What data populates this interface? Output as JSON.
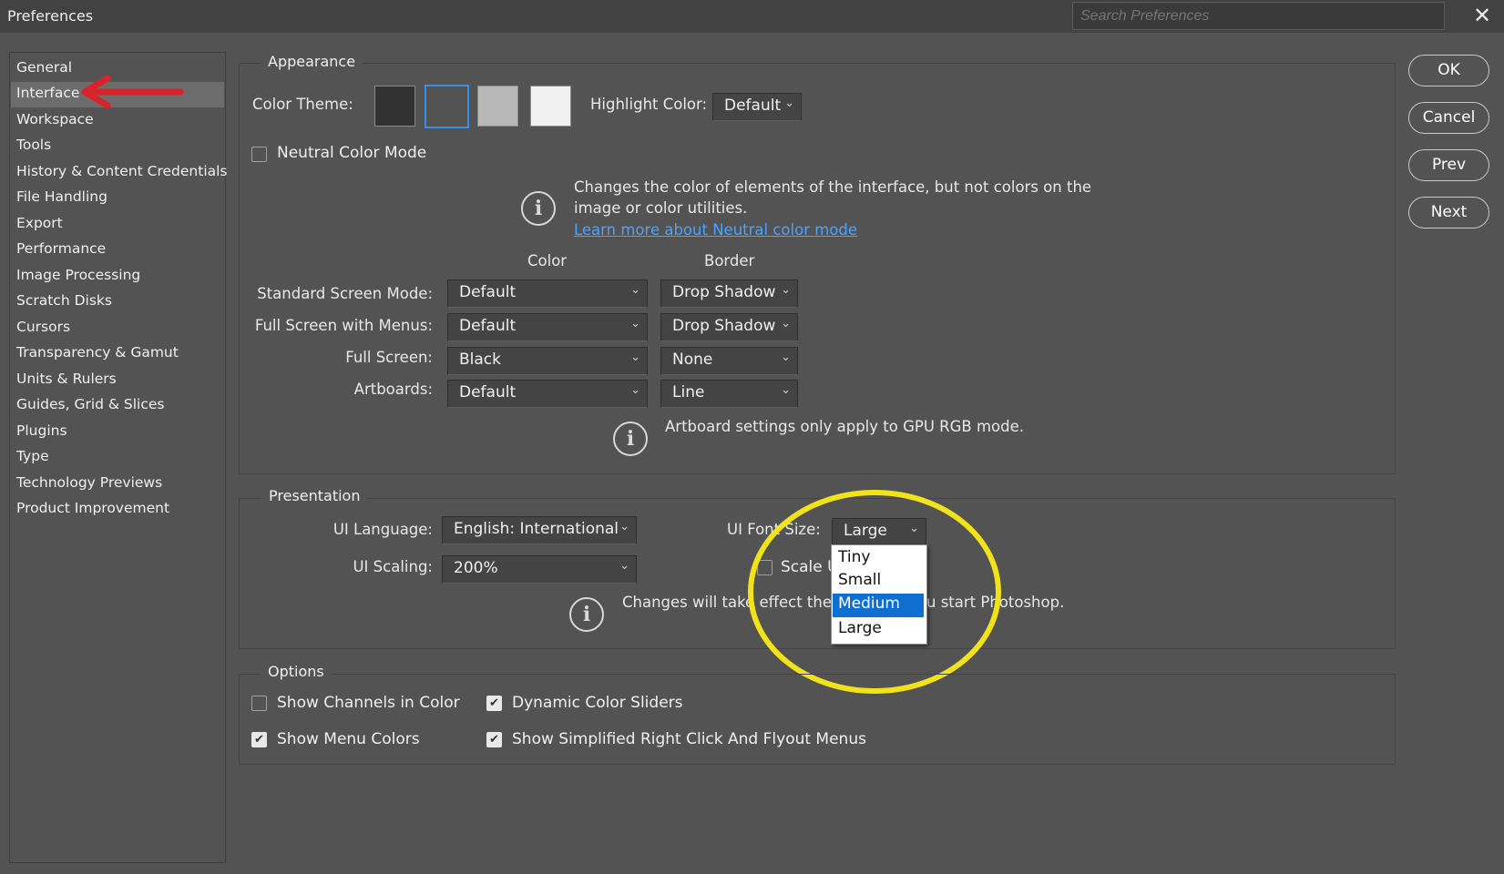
{
  "window": {
    "title": "Preferences",
    "search_placeholder": "Search Preferences",
    "close_glyph": "✕"
  },
  "sidebar": {
    "items": [
      {
        "label": "General"
      },
      {
        "label": "Interface"
      },
      {
        "label": "Workspace"
      },
      {
        "label": "Tools"
      },
      {
        "label": "History & Content Credentials"
      },
      {
        "label": "File Handling"
      },
      {
        "label": "Export"
      },
      {
        "label": "Performance"
      },
      {
        "label": "Image Processing"
      },
      {
        "label": "Scratch Disks"
      },
      {
        "label": "Cursors"
      },
      {
        "label": "Transparency & Gamut"
      },
      {
        "label": "Units & Rulers"
      },
      {
        "label": "Guides, Grid & Slices"
      },
      {
        "label": "Plugins"
      },
      {
        "label": "Type"
      },
      {
        "label": "Technology Previews"
      },
      {
        "label": "Product Improvement"
      }
    ],
    "selected": "Interface"
  },
  "appearance": {
    "legend": "Appearance",
    "color_theme_label": "Color Theme:",
    "theme_swatches": [
      "#323232",
      "#535353",
      "#b8b8b8",
      "#f0f0f0"
    ],
    "highlight_label": "Highlight Color:",
    "highlight_value": "Default",
    "neutral_mode_label": "Neutral Color Mode",
    "neutral_mode_checked": false,
    "neutral_info_text": "Changes the color of elements of the interface, but not colors on the image or color utilities.",
    "neutral_link": "Learn more about Neutral color mode",
    "col_color": "Color",
    "col_border": "Border",
    "rows": [
      {
        "label": "Standard Screen Mode:",
        "color": "Default",
        "border": "Drop Shadow"
      },
      {
        "label": "Full Screen with Menus:",
        "color": "Default",
        "border": "Drop Shadow"
      },
      {
        "label": "Full Screen:",
        "color": "Black",
        "border": "None"
      },
      {
        "label": "Artboards:",
        "color": "Default",
        "border": "Line"
      }
    ],
    "artboard_info": "Artboard settings only apply to GPU RGB mode."
  },
  "presentation": {
    "legend": "Presentation",
    "ui_language_label": "UI Language:",
    "ui_language_value": "English: International",
    "ui_font_size_label": "UI Font Size:",
    "ui_font_size_value": "Large",
    "ui_scaling_label": "UI Scaling:",
    "ui_scaling_value": "200%",
    "scale_label_partial": "Scale U",
    "info_text_left": "Changes will take effect the",
    "info_text_right": "u start Photoshop.",
    "font_size_options": [
      "Tiny",
      "Small",
      "Medium",
      "Large"
    ],
    "font_size_highlighted": "Medium"
  },
  "options": {
    "legend": "Options",
    "items": [
      {
        "label": "Show Channels in Color",
        "checked": false
      },
      {
        "label": "Dynamic Color Sliders",
        "checked": true
      },
      {
        "label": "Show Menu Colors",
        "checked": true
      },
      {
        "label": "Show Simplified Right Click And Flyout Menus",
        "checked": true
      }
    ]
  },
  "buttons": {
    "ok": "OK",
    "cancel": "Cancel",
    "prev": "Prev",
    "next": "Next"
  },
  "annotations": {
    "arrow_color": "#d9232a",
    "circle_color": "#f2e21b"
  },
  "icons": {
    "info": "i",
    "chevron": "⌄",
    "check": "✔"
  }
}
